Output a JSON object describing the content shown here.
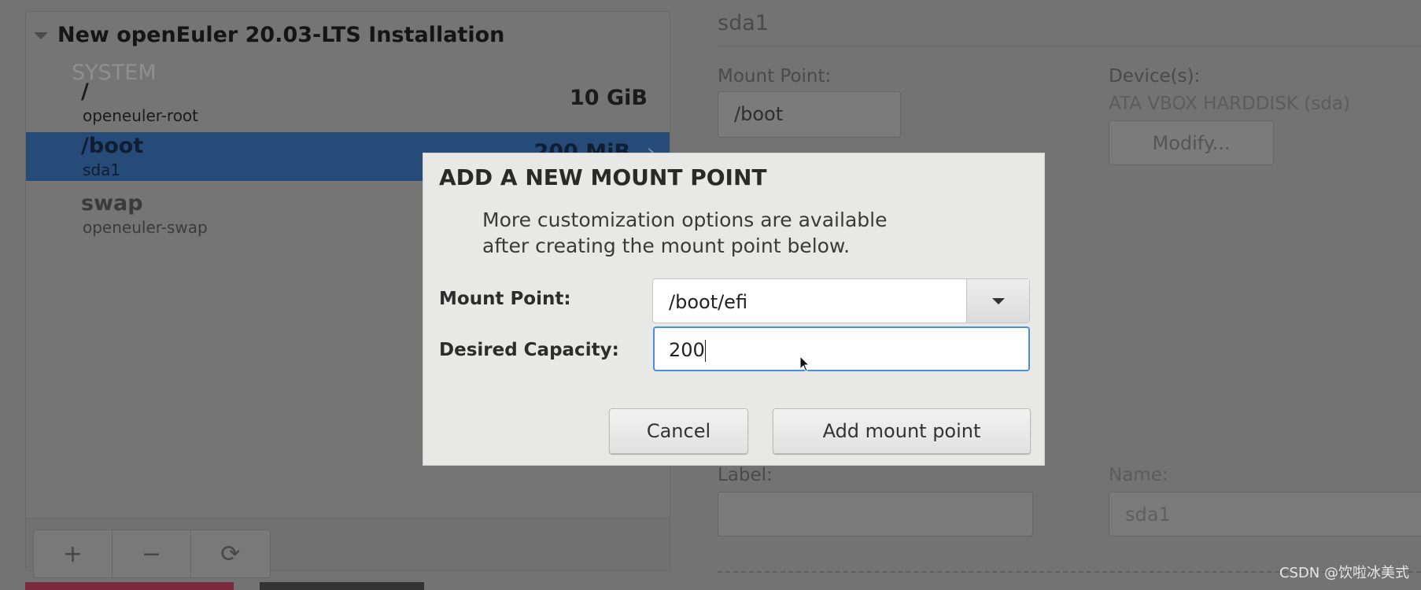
{
  "left_panel": {
    "title": "New openEuler 20.03-LTS Installation",
    "section": "SYSTEM",
    "rows": [
      {
        "mount_point": "/",
        "device": "openeuler-root",
        "size": "10 GiB",
        "selected": false
      },
      {
        "mount_point": "/boot",
        "device": "sda1",
        "size": "200 MiB",
        "selected": true
      },
      {
        "mount_point": "swap",
        "device": "openeuler-swap",
        "size": "",
        "selected": false
      }
    ],
    "toolbar": {
      "add": "+",
      "remove": "−",
      "refresh": "⟳"
    }
  },
  "details": {
    "header": "sda1",
    "mount_point_label": "Mount Point:",
    "mount_point_value": "/boot",
    "devices_label": "Device(s):",
    "devices_value": "ATA VBOX HARDDISK (sda)",
    "modify_label": "Modify...",
    "label_label": "Label:",
    "label_value": "",
    "name_label": "Name:",
    "name_value": "sda1"
  },
  "dialog": {
    "title": "ADD A NEW MOUNT POINT",
    "description_line1": "More customization options are available",
    "description_line2": "after creating the mount point below.",
    "mount_point_label": "Mount Point:",
    "mount_point_value": "/boot/efi",
    "capacity_label": "Desired Capacity:",
    "capacity_value": "200",
    "cancel_label": "Cancel",
    "add_label": "Add mount point"
  },
  "colors": {
    "selection": "#264b78",
    "focus": "#4a90d9",
    "overlay": "#737373"
  },
  "watermark": "CSDN @饮啦冰美式"
}
